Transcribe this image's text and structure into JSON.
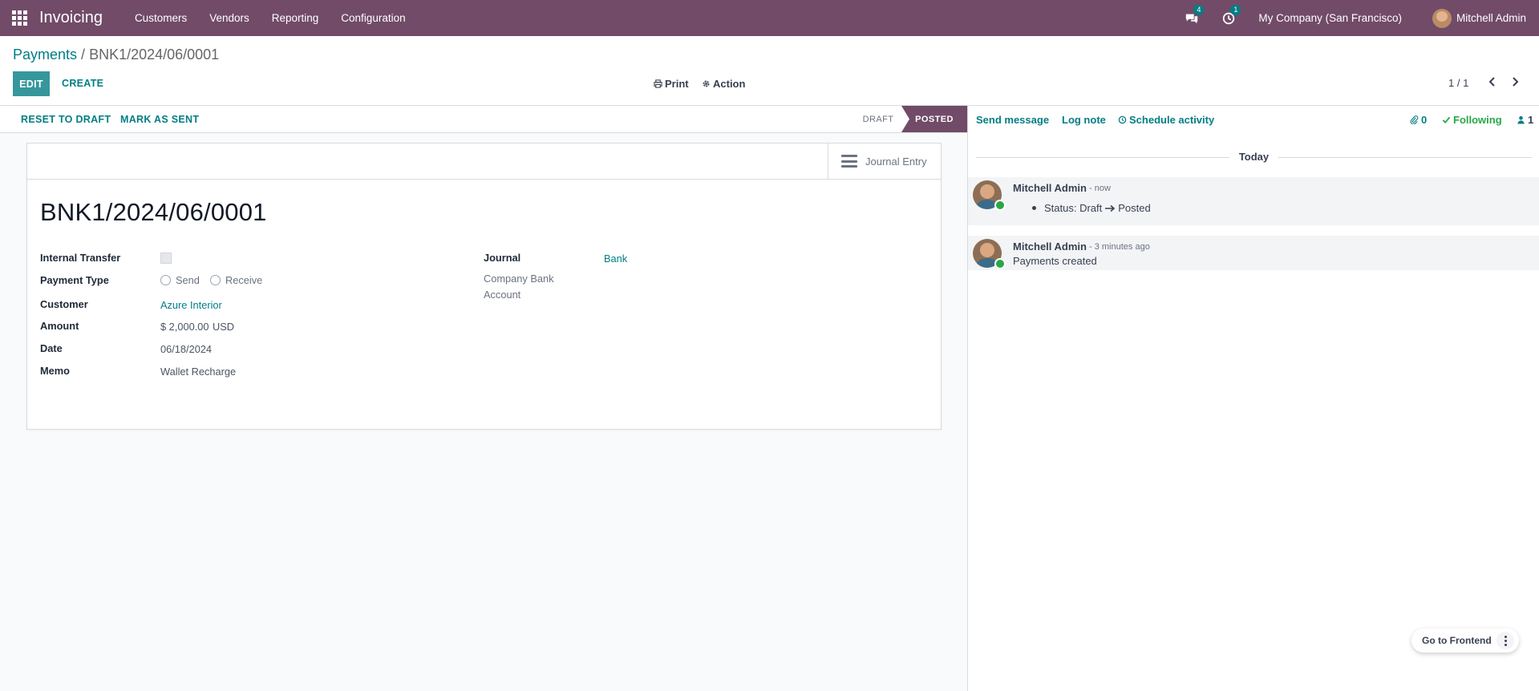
{
  "navbar": {
    "brand": "Invoicing",
    "menu": [
      "Customers",
      "Vendors",
      "Reporting",
      "Configuration"
    ],
    "messages_badge": "4",
    "activities_badge": "1",
    "company": "My Company (San Francisco)",
    "user": "Mitchell Admin",
    "accent_color": "#714b67"
  },
  "control": {
    "breadcrumb_parent": "Payments",
    "breadcrumb_sep": " / ",
    "breadcrumb_current": "BNK1/2024/06/0001",
    "edit_label": "EDIT",
    "create_label": "CREATE",
    "print_label": "Print",
    "action_label": "Action",
    "pager": "1 / 1"
  },
  "statusbar": {
    "reset_label": "RESET TO DRAFT",
    "mark_sent_label": "MARK AS SENT",
    "stage_draft": "DRAFT",
    "stage_posted": "POSTED"
  },
  "form": {
    "smart_button": "Journal Entry",
    "title": "BNK1/2024/06/0001",
    "labels": {
      "internal_transfer": "Internal Transfer",
      "payment_type": "Payment Type",
      "customer": "Customer",
      "amount": "Amount",
      "date": "Date",
      "memo": "Memo",
      "journal": "Journal",
      "company_bank_1": "Company Bank",
      "company_bank_2": "Account"
    },
    "values": {
      "payment_type_send": "Send",
      "payment_type_receive": "Receive",
      "customer": "Azure Interior",
      "amount": "$ 2,000.00",
      "currency": "USD",
      "date": "06/18/2024",
      "memo": "Wallet Recharge",
      "journal": "Bank"
    }
  },
  "chatter": {
    "send_message": "Send message",
    "log_note": "Log note",
    "schedule_activity": "Schedule activity",
    "attachments": "0",
    "following": "Following",
    "followers": "1",
    "today": "Today",
    "messages": [
      {
        "author": "Mitchell Admin",
        "when": "- now",
        "old_value": "Status: Draft",
        "new_value": "Posted"
      },
      {
        "author": "Mitchell Admin",
        "when": "- 3 minutes ago",
        "body": "Payments created"
      }
    ]
  },
  "frontend": {
    "label": "Go to Frontend"
  }
}
